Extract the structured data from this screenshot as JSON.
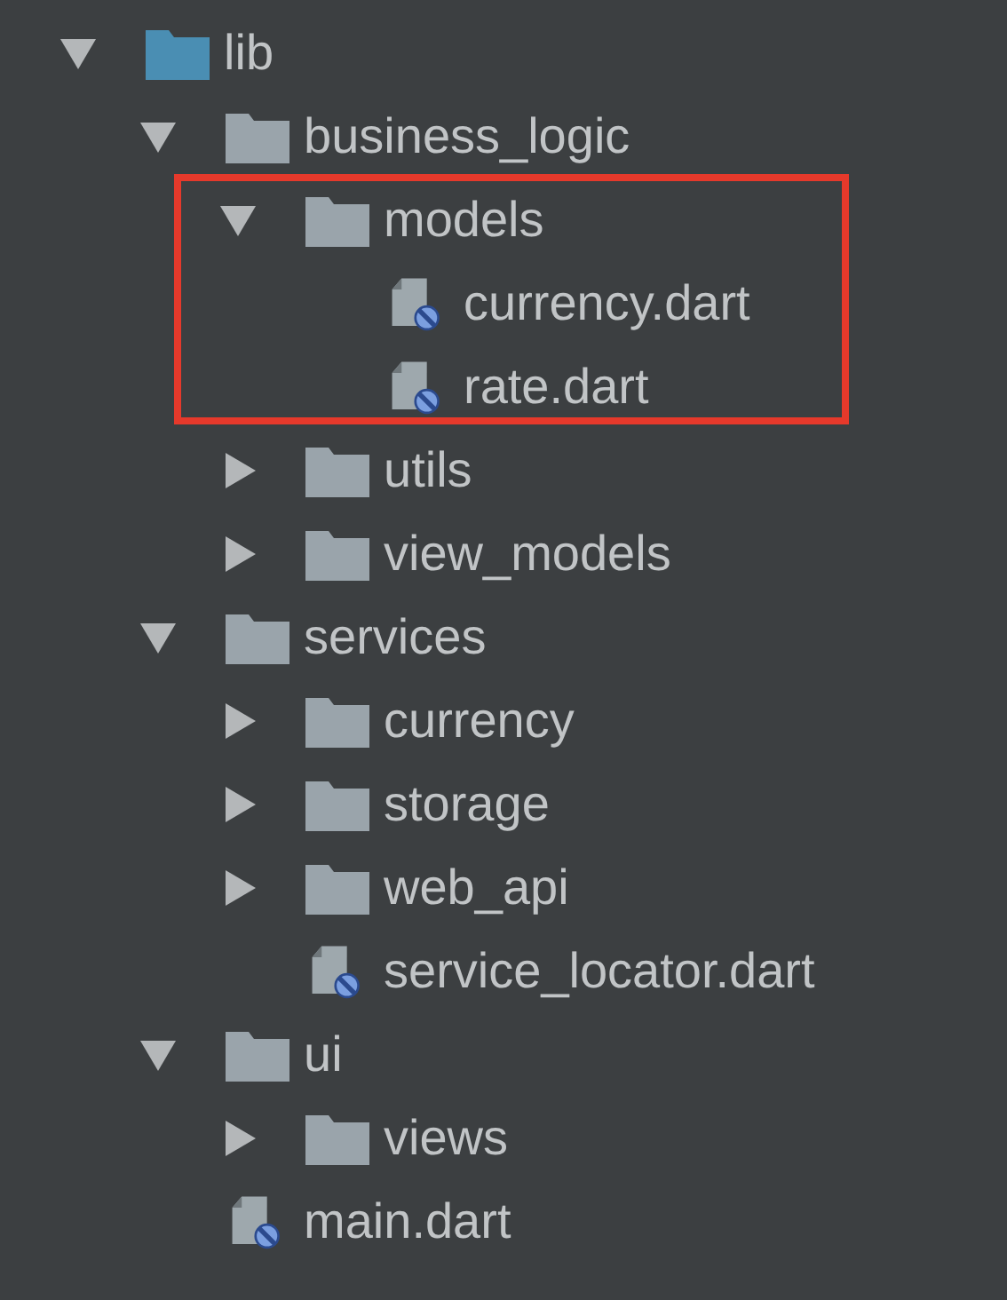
{
  "tree": [
    {
      "label": "lib",
      "kind": "source-folder",
      "expanded": true,
      "children": [
        {
          "label": "business_logic",
          "kind": "folder",
          "expanded": true,
          "children": [
            {
              "label": "models",
              "kind": "folder",
              "expanded": true,
              "highlighted": true,
              "children": [
                {
                  "label": "currency.dart",
                  "kind": "dart-file"
                },
                {
                  "label": "rate.dart",
                  "kind": "dart-file"
                }
              ]
            },
            {
              "label": "utils",
              "kind": "folder",
              "expanded": false
            },
            {
              "label": "view_models",
              "kind": "folder",
              "expanded": false
            }
          ]
        },
        {
          "label": "services",
          "kind": "folder",
          "expanded": true,
          "children": [
            {
              "label": "currency",
              "kind": "folder",
              "expanded": false
            },
            {
              "label": "storage",
              "kind": "folder",
              "expanded": false
            },
            {
              "label": "web_api",
              "kind": "folder",
              "expanded": false
            },
            {
              "label": "service_locator.dart",
              "kind": "dart-file"
            }
          ]
        },
        {
          "label": "ui",
          "kind": "folder",
          "expanded": true,
          "children": [
            {
              "label": "views",
              "kind": "folder",
              "expanded": false
            }
          ]
        },
        {
          "label": "main.dart",
          "kind": "dart-file"
        }
      ]
    }
  ]
}
